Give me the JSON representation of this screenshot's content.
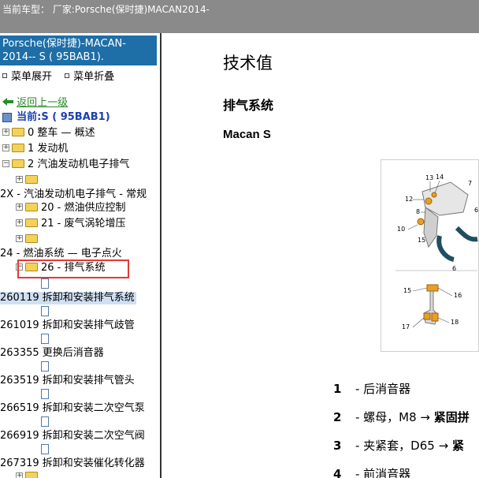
{
  "topbar": {
    "text": "当前车型：  厂家:Porsche(保时捷)MACAN2014-"
  },
  "sidebar": {
    "vehicle_line1": "Porsche(保时捷)-MACAN-",
    "vehicle_line2": "2014-- S ( 95BAB1).",
    "menu_expand": "菜单展开",
    "menu_collapse": "菜单折叠",
    "back_link": "返回上一级",
    "current_label": "当前:S ( 95BAB1)",
    "tree": [
      {
        "label": "0 整车 — 概述"
      },
      {
        "label": "1 发动机"
      },
      {
        "label": "2 汽油发动机电子排气"
      },
      {
        "label": "2X - 汽油发动机电子排气 - 常规"
      },
      {
        "label": "20 - 燃油供应控制"
      },
      {
        "label": "21 - 废气涡轮增压"
      },
      {
        "label": "24 - 燃油系统 — 电子点火"
      },
      {
        "label": "26 - 排气系统"
      },
      {
        "label": "260119 拆卸和安装排气系统"
      },
      {
        "label": "261019 拆卸和安装排气歧管"
      },
      {
        "label": "263355 更换后消音器"
      },
      {
        "label": "263519 拆卸和安装排气管头"
      },
      {
        "label": "266519 拆卸和安装二次空气泵"
      },
      {
        "label": "266919 拆卸和安装二次空气阀"
      },
      {
        "label": "267319 拆卸和安装催化转化器"
      }
    ]
  },
  "content": {
    "title": "技术值",
    "section": "排气系统",
    "model": "Macan S",
    "figure_labels": [
      "13",
      "14",
      "12",
      "8",
      "7",
      "6",
      "10",
      "15",
      "6",
      "15",
      "16",
      "17",
      "18"
    ],
    "legend": [
      {
        "num": "1",
        "text": "- 后消音器",
        "bold_tail": ""
      },
      {
        "num": "2",
        "text": "- 螺母，M8 → ",
        "bold_tail": "紧固拼"
      },
      {
        "num": "3",
        "text": "- 夹紧套，D65 → ",
        "bold_tail": "紧"
      },
      {
        "num": "4",
        "text": "- 前消音器",
        "bold_tail": ""
      }
    ]
  }
}
